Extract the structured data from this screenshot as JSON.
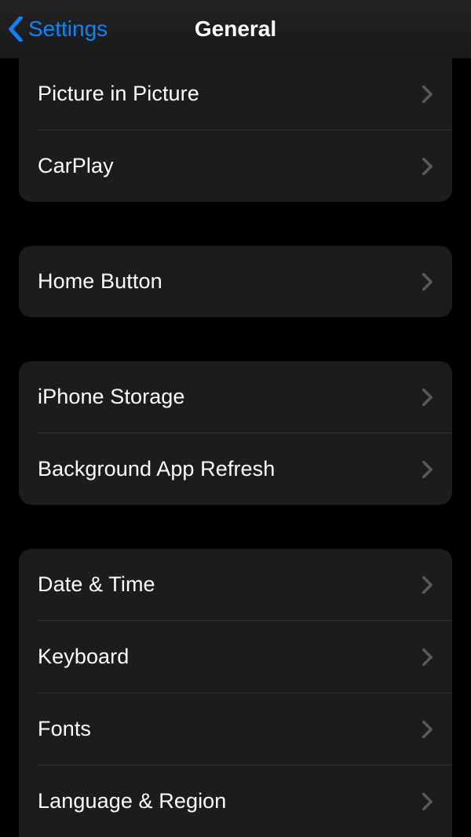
{
  "nav": {
    "back_label": "Settings",
    "title": "General"
  },
  "groups": [
    {
      "id": "g0",
      "partial": "top",
      "rows": [
        {
          "label": "Picture in Picture"
        },
        {
          "label": "CarPlay"
        }
      ]
    },
    {
      "id": "g1",
      "rows": [
        {
          "label": "Home Button"
        }
      ]
    },
    {
      "id": "g2",
      "rows": [
        {
          "label": "iPhone Storage"
        },
        {
          "label": "Background App Refresh"
        }
      ]
    },
    {
      "id": "g3",
      "partial": "bottom",
      "rows": [
        {
          "label": "Date & Time"
        },
        {
          "label": "Keyboard"
        },
        {
          "label": "Fonts"
        },
        {
          "label": "Language & Region"
        }
      ]
    }
  ],
  "colors": {
    "accent": "#0a84ff",
    "chevron": "#5a5a5e"
  }
}
